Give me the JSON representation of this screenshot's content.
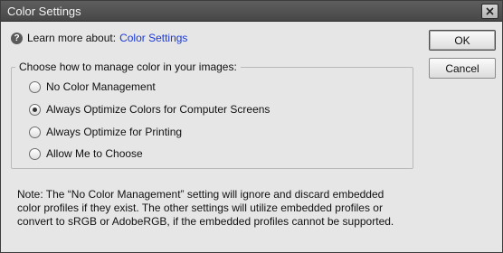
{
  "window": {
    "title": "Color Settings"
  },
  "help": {
    "icon": "question-circle-icon",
    "prefix": "Learn more about:",
    "link": "Color Settings",
    "link_color": "#1a38d8"
  },
  "group": {
    "legend": "Choose how to manage color in your images:",
    "options": [
      {
        "label": "No Color Management",
        "checked": false
      },
      {
        "label": "Always Optimize Colors for Computer Screens",
        "checked": true
      },
      {
        "label": "Always Optimize for Printing",
        "checked": false
      },
      {
        "label": "Allow Me to Choose",
        "checked": false
      }
    ]
  },
  "buttons": {
    "ok": "OK",
    "cancel": "Cancel"
  },
  "note": {
    "line1": "Note: The “No Color Management” setting will ignore and discard embedded",
    "line2": "color profiles if they exist. The other settings will utilize embedded profiles or",
    "line3": "convert to sRGB or AdobeRGB, if the embedded profiles cannot be supported."
  }
}
